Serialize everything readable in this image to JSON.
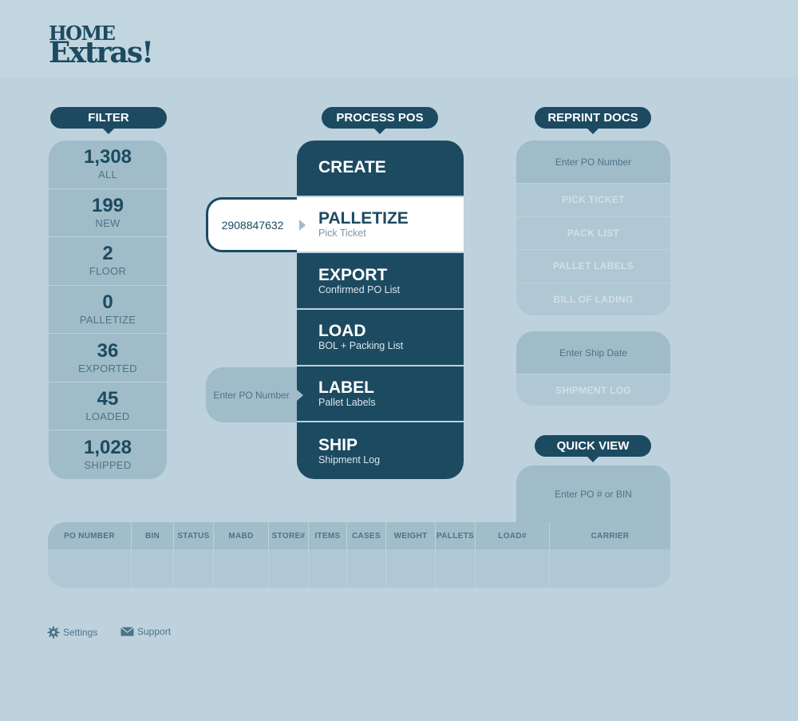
{
  "brand": {
    "line1": "HOME",
    "line2": "Extras!"
  },
  "filter": {
    "title": "FILTER",
    "items": [
      {
        "count": "1,308",
        "label": "ALL"
      },
      {
        "count": "199",
        "label": "NEW"
      },
      {
        "count": "2",
        "label": "FLOOR"
      },
      {
        "count": "0",
        "label": "PALLETIZE"
      },
      {
        "count": "36",
        "label": "EXPORTED"
      },
      {
        "count": "45",
        "label": "LOADED"
      },
      {
        "count": "1,028",
        "label": "SHIPPED"
      }
    ]
  },
  "process": {
    "title": "PROCESS POS",
    "items": [
      {
        "title": "CREATE",
        "subtitle": ""
      },
      {
        "title": "PALLETIZE",
        "subtitle": "Pick Ticket"
      },
      {
        "title": "EXPORT",
        "subtitle": "Confirmed PO List"
      },
      {
        "title": "LOAD",
        "subtitle": "BOL + Packing List"
      },
      {
        "title": "LABEL",
        "subtitle": "Pallet Labels"
      },
      {
        "title": "SHIP",
        "subtitle": "Shipment Log"
      }
    ],
    "ticket_value": "2908847632",
    "label_placeholder": "Enter PO Number"
  },
  "reprint": {
    "title": "REPRINT DOCS",
    "po_placeholder": "Enter PO Number",
    "docs": [
      "PICK TICKET",
      "PACK LIST",
      "PALLET LABELS",
      "BILL OF LADING"
    ],
    "ship_date_placeholder": "Enter Ship Date",
    "shipment_log": "SHIPMENT LOG"
  },
  "quick_view": {
    "title": "QUICK VIEW",
    "placeholder": "Enter PO # or BIN"
  },
  "table": {
    "columns": [
      "PO NUMBER",
      "BIN",
      "STATUS",
      "MABD",
      "STORE#",
      "ITEMS",
      "CASES",
      "WEIGHT",
      "PALLETS",
      "LOAD#",
      "CARRIER"
    ]
  },
  "footer": {
    "settings": "Settings",
    "support": "Support"
  },
  "colors": {
    "primary": "#1c4a61",
    "background": "#bdd2dd",
    "panel": "#9fbcc8",
    "active": "#ffffff"
  }
}
